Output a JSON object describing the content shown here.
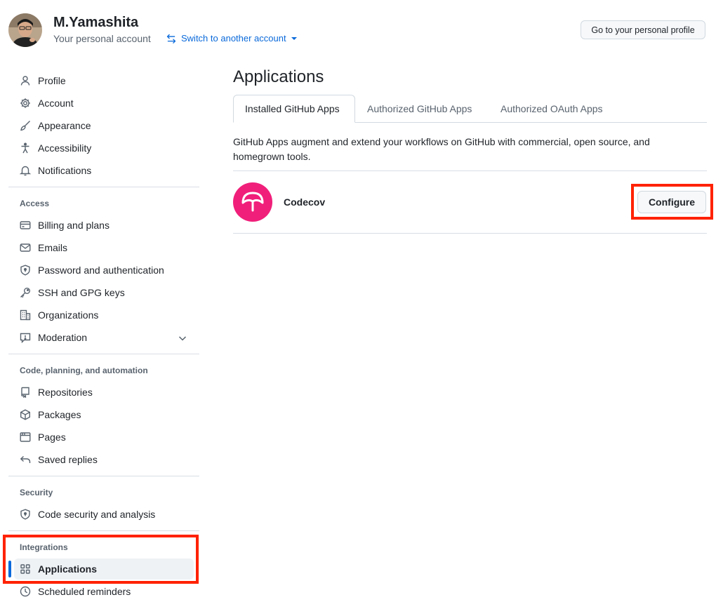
{
  "header": {
    "user_name": "M.Yamashita",
    "account_type": "Your personal account",
    "switch_label": "Switch to another account",
    "profile_button": "Go to your personal profile"
  },
  "sidebar": {
    "top_items": [
      {
        "label": "Profile",
        "icon": "person-icon"
      },
      {
        "label": "Account",
        "icon": "gear-icon"
      },
      {
        "label": "Appearance",
        "icon": "paintbrush-icon"
      },
      {
        "label": "Accessibility",
        "icon": "accessibility-icon"
      },
      {
        "label": "Notifications",
        "icon": "bell-icon"
      }
    ],
    "sections": [
      {
        "title": "Access",
        "items": [
          {
            "label": "Billing and plans",
            "icon": "credit-card-icon"
          },
          {
            "label": "Emails",
            "icon": "mail-icon"
          },
          {
            "label": "Password and authentication",
            "icon": "shield-lock-icon"
          },
          {
            "label": "SSH and GPG keys",
            "icon": "key-icon"
          },
          {
            "label": "Organizations",
            "icon": "organization-icon"
          },
          {
            "label": "Moderation",
            "icon": "report-icon"
          }
        ]
      },
      {
        "title": "Code, planning, and automation",
        "items": [
          {
            "label": "Repositories",
            "icon": "repo-icon"
          },
          {
            "label": "Packages",
            "icon": "package-icon"
          },
          {
            "label": "Pages",
            "icon": "browser-icon"
          },
          {
            "label": "Saved replies",
            "icon": "reply-icon"
          }
        ]
      },
      {
        "title": "Security",
        "items": [
          {
            "label": "Code security and analysis",
            "icon": "shield-lock-icon"
          }
        ]
      },
      {
        "title": "Integrations",
        "items": [
          {
            "label": "Applications",
            "icon": "apps-icon"
          },
          {
            "label": "Scheduled reminders",
            "icon": "clock-icon"
          }
        ]
      }
    ]
  },
  "main": {
    "title": "Applications",
    "tabs": [
      {
        "label": "Installed GitHub Apps",
        "active": true
      },
      {
        "label": "Authorized GitHub Apps",
        "active": false
      },
      {
        "label": "Authorized OAuth Apps",
        "active": false
      }
    ],
    "description": "GitHub Apps augment and extend your workflows on GitHub with commercial, open source, and homegrown tools.",
    "apps": [
      {
        "name": "Codecov",
        "action": "Configure",
        "logo_color": "#f01f7a"
      }
    ]
  },
  "colors": {
    "accent": "#0969da",
    "highlight": "#ff2200",
    "codecov": "#f01f7a"
  }
}
